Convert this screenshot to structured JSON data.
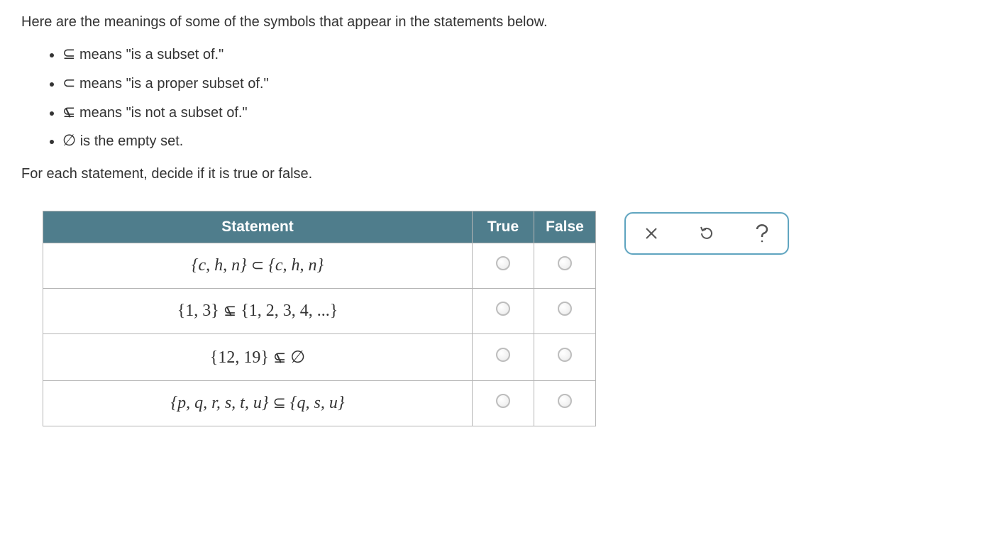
{
  "intro": "Here are the meanings of some of the symbols that appear in the statements below.",
  "defs": {
    "subset": "means \"is a subset of.\"",
    "proper": "means \"is a proper subset of.\"",
    "notsubset": "means \"is not a subset of.\"",
    "empty": "is the empty set."
  },
  "instruction": "For each statement, decide if it is true or false.",
  "headers": {
    "statement": "Statement",
    "true": "True",
    "false": "False"
  },
  "rows": {
    "r1": {
      "left": "{c, h, n}",
      "sym": "⊂",
      "right": "{c, h, n}",
      "not": false
    },
    "r2": {
      "left": "{1, 3}",
      "sym": "⊆",
      "right": "{1, 2, 3, 4, ...}",
      "not": true,
      "numeric": true
    },
    "r3": {
      "left": "{12, 19}",
      "sym": "⊆",
      "right": "∅",
      "not": true,
      "numeric": true
    },
    "r4": {
      "left": "{p, q, r, s, t, u}",
      "sym": "⊆",
      "right": "{q, s, u}",
      "not": false
    }
  },
  "symbols": {
    "subset_eq": "⊆",
    "proper_subset": "⊂",
    "empty_set": "∅"
  }
}
